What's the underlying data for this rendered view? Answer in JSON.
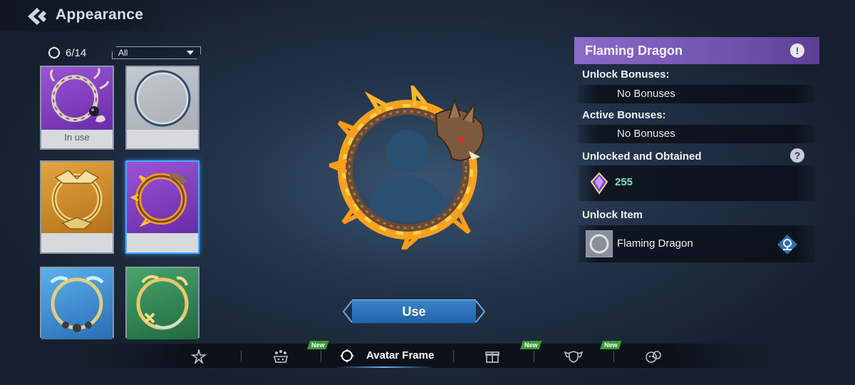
{
  "header": {
    "title": "Appearance",
    "back_icon": "back-arrow-icon"
  },
  "collection": {
    "count": "6/14",
    "filter_value": "All"
  },
  "tiles": [
    {
      "color": "#8a45c9",
      "status": "In use",
      "frame": "pearl-coral-frame"
    },
    {
      "color": "#b6bbc1",
      "status": "",
      "frame": "plain-silver-frame"
    },
    {
      "color": "#cc8a2c",
      "status": "",
      "frame": "golden-ornate-frame"
    },
    {
      "color": "#8a45c9",
      "status": "",
      "frame": "flaming-dragon-frame",
      "selected": true
    },
    {
      "color": "#3c8ed0",
      "status": "",
      "frame": "wave-pearl-frame"
    },
    {
      "color": "#2f8a52",
      "status": "",
      "frame": "golden-leaf-frame"
    }
  ],
  "preview": {
    "frame_name": "Flaming Dragon"
  },
  "use_button": {
    "label": "Use"
  },
  "details": {
    "name": "Flaming Dragon",
    "unlock_bonuses_title": "Unlock Bonuses:",
    "unlock_bonuses_value": "No Bonuses",
    "active_bonuses_title": "Active Bonuses:",
    "active_bonuses_value": "No Bonuses",
    "unlocked_title": "Unlocked and Obtained",
    "unlocked_value": "255",
    "unlock_item_title": "Unlock Item",
    "unlock_item_name": "Flaming Dragon"
  },
  "bottom_nav": {
    "items": [
      {
        "icon": "star-burst-icon",
        "new": false
      },
      {
        "icon": "crown-dots-icon",
        "new": true,
        "new_label": "New"
      },
      {
        "icon": "avatar-frame-icon",
        "label": "Avatar Frame",
        "active": true
      },
      {
        "icon": "gift-box-icon",
        "new": true,
        "new_label": "New"
      },
      {
        "icon": "shield-wings-icon",
        "new": true,
        "new_label": "New"
      },
      {
        "icon": "emote-icon",
        "new": false
      }
    ]
  },
  "colors": {
    "accent_blue": "#2f74bd",
    "name_bar_purple": "#7a5cba",
    "value_green": "#7ee0b8",
    "new_badge_green": "#3b9a3a"
  }
}
